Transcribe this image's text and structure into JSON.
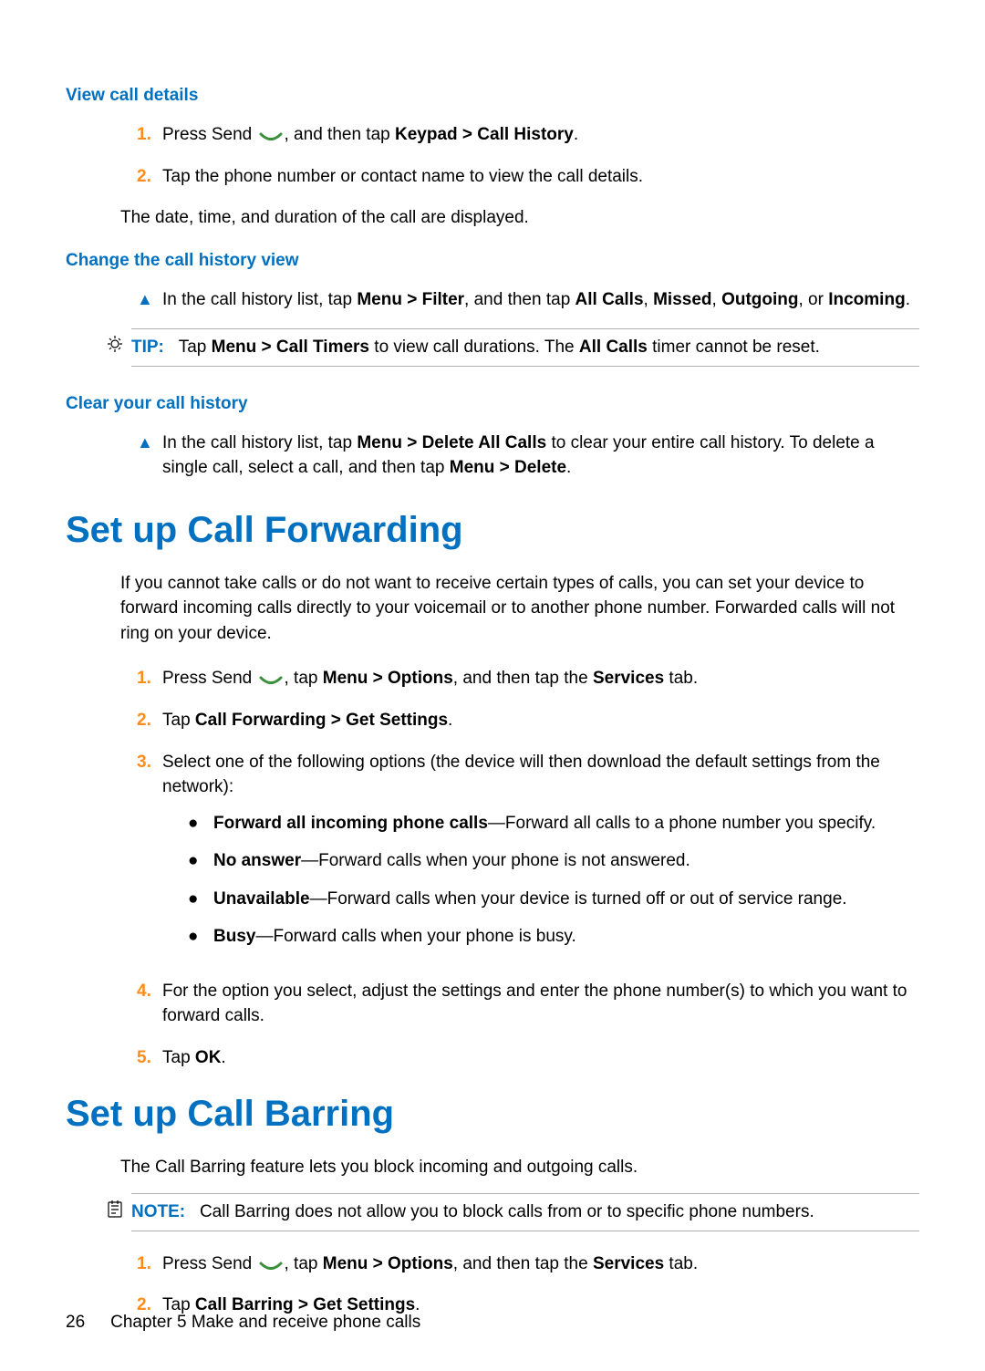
{
  "section_view_details": {
    "heading": "View call details",
    "step1_a": "Press Send ",
    "step1_b": ", and then tap ",
    "step1_kb": "Keypad > Call History",
    "step1_c": ".",
    "step2": "Tap the phone number or contact name to view the call details.",
    "result": "The date, time, and duration of the call are displayed."
  },
  "section_change_view": {
    "heading": "Change the call history view",
    "body_a": "In the call history list, tap ",
    "body_b1": "Menu > Filter",
    "body_c": ", and then tap ",
    "body_b2": "All Calls",
    "body_d": ", ",
    "body_b3": "Missed",
    "body_e": ", ",
    "body_b4": "Outgoing",
    "body_f": ", or ",
    "body_b5": "Incoming",
    "body_g": ".",
    "tip_label": "TIP:",
    "tip_a": "Tap ",
    "tip_b1": "Menu > Call Timers",
    "tip_c": " to view call durations. The ",
    "tip_b2": "All Calls",
    "tip_d": " timer cannot be reset."
  },
  "section_clear": {
    "heading": "Clear your call history",
    "body_a": "In the call history list, tap ",
    "body_b1": "Menu > Delete All Calls",
    "body_c": " to clear your entire call history. To delete a single call, select a call, and then tap ",
    "body_b2": "Menu > Delete",
    "body_d": "."
  },
  "section_forwarding": {
    "heading": "Set up Call Forwarding",
    "intro": "If you cannot take calls or do not want to receive certain types of calls, you can set your device to forward incoming calls directly to your voicemail or to another phone number. Forwarded calls will not ring on your device.",
    "step1_a": "Press Send ",
    "step1_b": ", tap ",
    "step1_k1": "Menu > Options",
    "step1_c": ", and then tap the ",
    "step1_k2": "Services",
    "step1_d": " tab.",
    "step2_a": "Tap ",
    "step2_b": "Call Forwarding > Get Settings",
    "step2_c": ".",
    "step3": "Select one of the following options (the device will then download the default settings from the network):",
    "opt1_b": "Forward all incoming phone calls",
    "opt1_t": "—Forward all calls to a phone number you specify.",
    "opt2_b": "No answer",
    "opt2_t": "—Forward calls when your phone is not answered.",
    "opt3_b": "Unavailable",
    "opt3_t": "—Forward calls when your device is turned off or out of service range.",
    "opt4_b": "Busy",
    "opt4_t": "—Forward calls when your phone is busy.",
    "step4": "For the option you select, adjust the settings and enter the phone number(s) to which you want to forward calls.",
    "step5_a": "Tap ",
    "step5_b": "OK",
    "step5_c": "."
  },
  "section_barring": {
    "heading": "Set up Call Barring",
    "intro": "The Call Barring feature lets you block incoming and outgoing calls.",
    "note_label": "NOTE:",
    "note_body": "Call Barring does not allow you to block calls from or to specific phone numbers.",
    "step1_a": "Press Send ",
    "step1_b": ", tap ",
    "step1_k1": "Menu > Options",
    "step1_c": ", and then tap the ",
    "step1_k2": "Services",
    "step1_d": " tab.",
    "step2_a": "Tap ",
    "step2_b": "Call Barring > Get Settings",
    "step2_c": "."
  },
  "footer": {
    "page_number": "26",
    "chapter": "Chapter 5   Make and receive phone calls"
  },
  "nums": {
    "n1": "1.",
    "n2": "2.",
    "n3": "3.",
    "n4": "4.",
    "n5": "5."
  }
}
